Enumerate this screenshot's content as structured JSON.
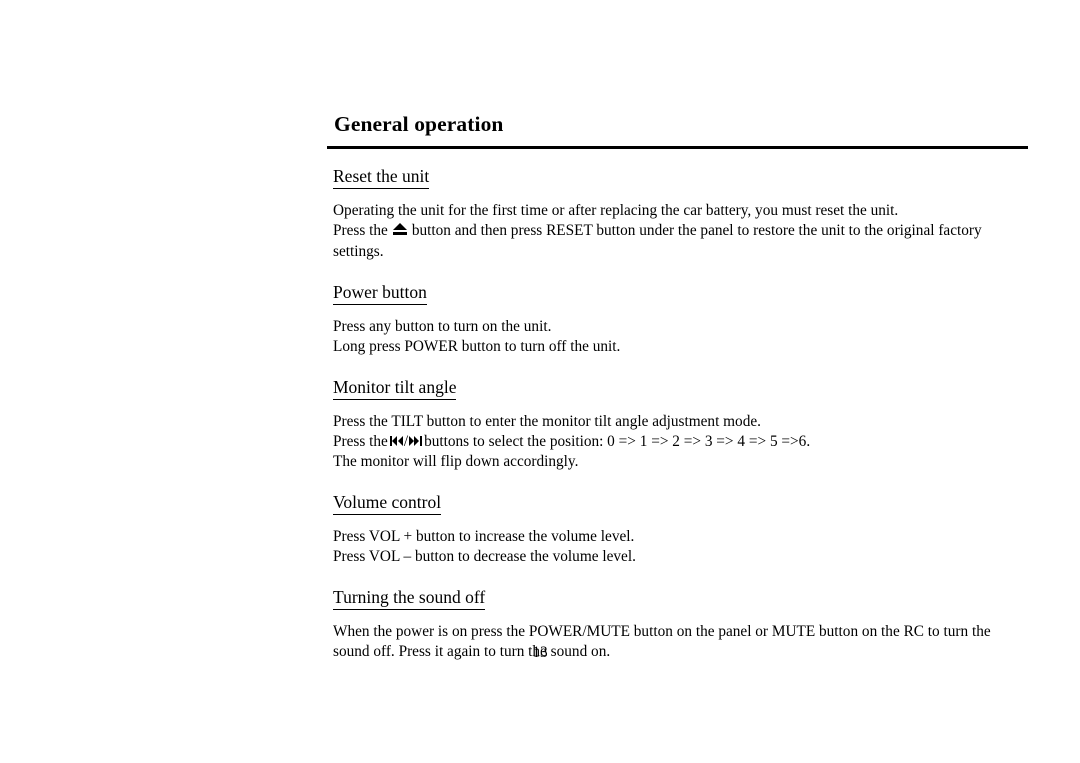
{
  "document": {
    "title": "General operation",
    "page_number": "13",
    "sections": [
      {
        "heading": "Reset the unit",
        "lines": [
          "Operating the unit for the first time or after replacing the car battery, you must reset the unit.",
          "Press the  [eject-icon]  button and then press RESET button under the panel to restore the unit to the original factory settings."
        ],
        "line1": "Operating the unit for the first time or after replacing the car battery, you must reset the unit.",
        "line2_prefix": "Press the",
        "line2_suffix": "button and then press RESET button under the panel to restore the unit to the original factory settings."
      },
      {
        "heading": "Power button",
        "line1": "Press any button to turn on the unit.",
        "line2": "Long press POWER button to turn off the unit."
      },
      {
        "heading": "Monitor tilt angle",
        "line1": "Press the TILT button to enter the monitor tilt angle adjustment mode.",
        "line2_prefix": "Press the",
        "line2_separator": "/",
        "line2_suffix": "buttons to select the position: 0 => 1 => 2 => 3 => 4 => 5 =>6.",
        "line3": "The monitor will flip down accordingly."
      },
      {
        "heading": "Volume control",
        "line1": "Press VOL + button to increase the volume level.",
        "line2": "Press VOL – button to decrease the volume level."
      },
      {
        "heading": "Turning the sound off",
        "line1": "When the power is on press the POWER/MUTE button on the panel or MUTE button on the RC to turn the sound off. Press it again to turn the sound on."
      }
    ],
    "icons": {
      "eject": "eject-icon",
      "skip_backward": "skip-backward-icon",
      "skip_forward": "skip-forward-icon"
    },
    "colors": {
      "text": "#000000",
      "background": "#ffffff",
      "rule": "#000000"
    }
  }
}
